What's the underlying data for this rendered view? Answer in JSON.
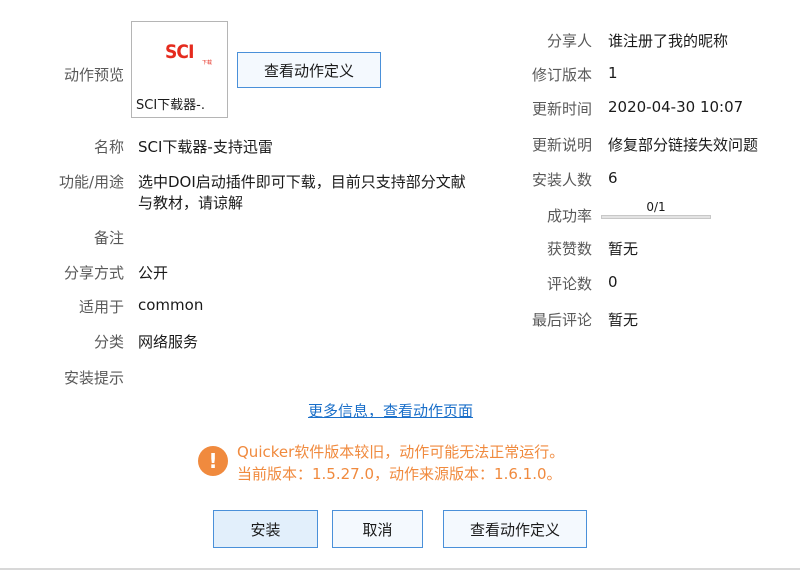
{
  "left": {
    "preview_label": "动作预览",
    "preview_caption": "SCI下载器-.",
    "logo_text": "SCI",
    "logo_subtext": "下载",
    "view_definition_button": "查看动作定义",
    "name_label": "名称",
    "name_value": "SCI下载器-支持迅雷",
    "function_label": "功能/用途",
    "function_value_line1": "选中DOI启动插件即可下载，目前只支持部分文献",
    "function_value_line2": "与教材，请谅解",
    "remark_label": "备注",
    "share_mode_label": "分享方式",
    "share_mode_value": "公开",
    "applies_label": "适用于",
    "applies_value": "common",
    "category_label": "分类",
    "category_value": "网络服务",
    "install_tip_label": "安装提示"
  },
  "right": {
    "sharer_label": "分享人",
    "sharer_value": "谁注册了我的昵称",
    "revision_label": "修订版本",
    "revision_value": "1",
    "update_time_label": "更新时间",
    "update_time_value": "2020-04-30 10:07",
    "update_note_label": "更新说明",
    "update_note_value": "修复部分链接失效问题",
    "install_count_label": "安装人数",
    "install_count_value": "6",
    "success_rate_label": "成功率",
    "success_rate_value": "0/1",
    "success_rate_fraction": 0,
    "likes_label": "获赞数",
    "likes_value": "暂无",
    "comments_label": "评论数",
    "comments_value": "0",
    "last_comment_label": "最后评论",
    "last_comment_value": "暂无"
  },
  "more_info_link": "更多信息，查看动作页面",
  "warning": {
    "line1": "Quicker软件版本较旧，动作可能无法正常运行。",
    "line2": "当前版本：1.5.27.0，动作来源版本：1.6.1.0。",
    "icon": "!",
    "color": "#f08a3e"
  },
  "buttons": {
    "install": "安装",
    "cancel": "取消",
    "view_definition": "查看动作定义"
  },
  "colors": {
    "accent": "#4a90d9",
    "link": "#1a6fc9",
    "warning": "#f08a3e",
    "logo": "#e52b1e"
  }
}
